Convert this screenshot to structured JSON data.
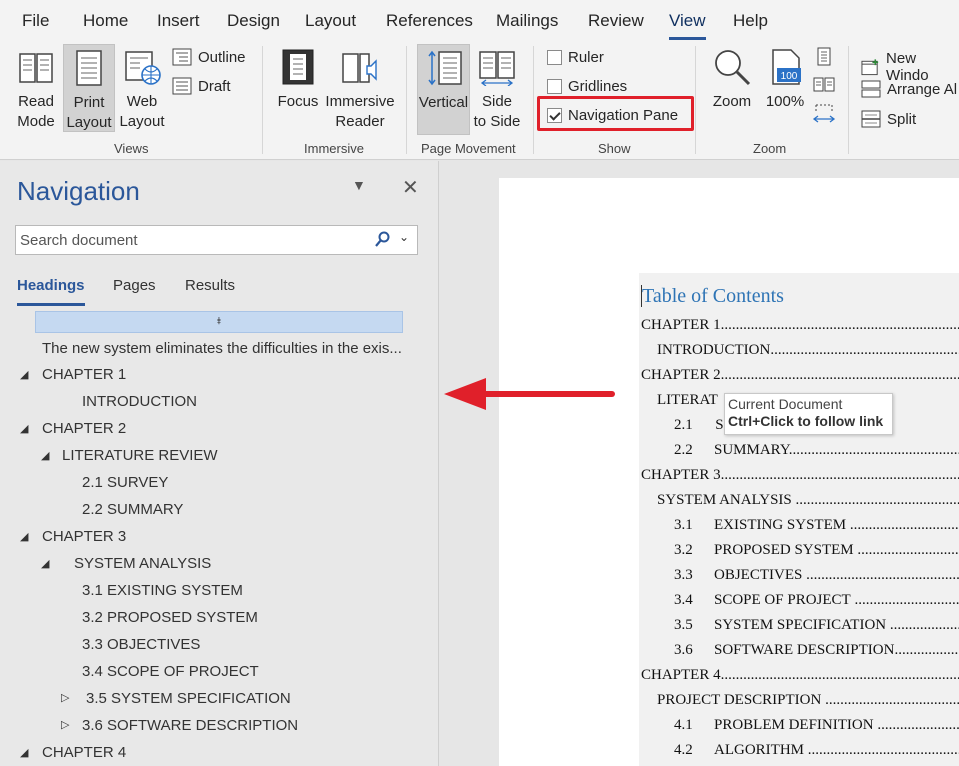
{
  "menu": {
    "tabs": [
      "File",
      "Home",
      "Insert",
      "Design",
      "Layout",
      "References",
      "Mailings",
      "Review",
      "View",
      "Help"
    ],
    "active": "View"
  },
  "ribbon": {
    "views": {
      "read_mode": [
        "Read",
        "Mode"
      ],
      "print_layout": [
        "Print",
        "Layout"
      ],
      "web_layout": [
        "Web",
        "Layout"
      ],
      "outline": "Outline",
      "draft": "Draft",
      "label": "Views"
    },
    "immersive": {
      "focus": "Focus",
      "immersive_reader": [
        "Immersive",
        "Reader"
      ],
      "label": "Immersive"
    },
    "page_movement": {
      "vertical": "Vertical",
      "side_to_side": [
        "Side",
        "to Side"
      ],
      "label": "Page Movement"
    },
    "show": {
      "ruler": "Ruler",
      "gridlines": "Gridlines",
      "navigation_pane": "Navigation Pane",
      "ruler_checked": false,
      "gridlines_checked": false,
      "navigation_pane_checked": true,
      "label": "Show"
    },
    "zoom": {
      "zoom": "Zoom",
      "hundred": "100%",
      "hundred_icon_text": "100",
      "label": "Zoom"
    },
    "window": {
      "new_window": "New Windo",
      "arrange_all": "Arrange Al",
      "split": "Split"
    }
  },
  "navigation": {
    "title": "Navigation",
    "search_placeholder": "Search document",
    "tabs": [
      "Headings",
      "Pages",
      "Results"
    ],
    "active_tab": "Headings",
    "collapse_glyph": "⯒",
    "items": [
      "The new system eliminates the difficulties in the exis...",
      "CHAPTER 1",
      "INTRODUCTION",
      "CHAPTER 2",
      "LITERATURE REVIEW",
      "2.1 SURVEY",
      "2.2 SUMMARY",
      "CHAPTER 3",
      "SYSTEM ANALYSIS",
      "3.1 EXISTING SYSTEM",
      "3.2 PROPOSED SYSTEM",
      "3.3 OBJECTIVES",
      "3.4 SCOPE OF PROJECT",
      "3.5  SYSTEM SPECIFICATION",
      "3.6 SOFTWARE DESCRIPTION",
      "CHAPTER 4"
    ]
  },
  "document": {
    "toc_title": "Table of Contents",
    "entries": [
      {
        "num": "",
        "text": "CHAPTER 1"
      },
      {
        "num": "",
        "text": "INTRODUCTION"
      },
      {
        "num": "",
        "text": "CHAPTER 2"
      },
      {
        "num": "",
        "text": "LITERAT"
      },
      {
        "num": "2.1",
        "text": "S"
      },
      {
        "num": "2.2",
        "text": "SUMMARY"
      },
      {
        "num": "",
        "text": "CHAPTER 3"
      },
      {
        "num": "",
        "text": "SYSTEM ANALYSIS"
      },
      {
        "num": "3.1",
        "text": "EXISTING SYSTEM"
      },
      {
        "num": "3.2",
        "text": "PROPOSED SYSTEM"
      },
      {
        "num": "3.3",
        "text": "OBJECTIVES"
      },
      {
        "num": "3.4",
        "text": "SCOPE OF PROJECT"
      },
      {
        "num": "3.5",
        "text": "SYSTEM SPECIFICATION"
      },
      {
        "num": "3.6",
        "text": "SOFTWARE DESCRIPTION"
      },
      {
        "num": "",
        "text": "CHAPTER 4"
      },
      {
        "num": "",
        "text": "PROJECT DESCRIPTION"
      },
      {
        "num": "4.1",
        "text": "PROBLEM DEFINITION"
      },
      {
        "num": "4.2",
        "text": "ALGORITHM"
      }
    ],
    "tooltip": {
      "line1": "Current Document",
      "line2": "Ctrl+Click to follow link"
    }
  },
  "colors": {
    "accent": "#2b579a",
    "highlight": "#e0202a",
    "toc_title": "#2e74b5"
  }
}
